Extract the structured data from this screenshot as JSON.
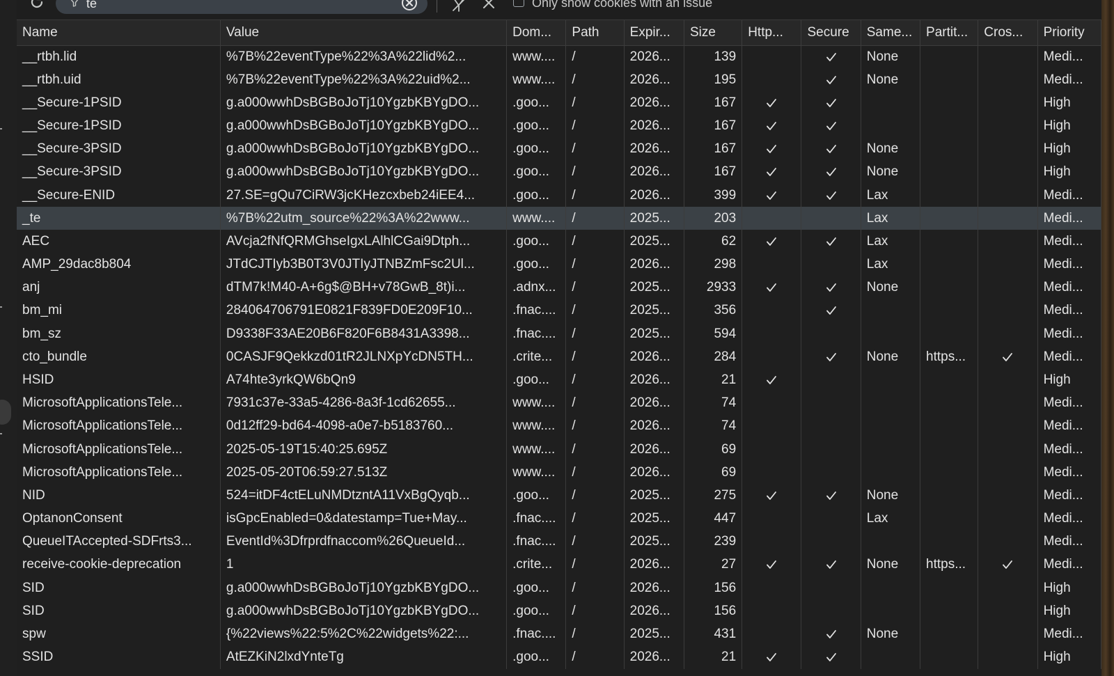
{
  "toolbar": {
    "filter_value": "te",
    "only_issue_label": "Only show cookies with an issue"
  },
  "icons": [
    "refresh-icon",
    "filter-icon",
    "clear-input-icon",
    "clear-filtered-cookies-icon",
    "delete-all-icon"
  ],
  "columns": [
    "Name",
    "Value",
    "Dom...",
    "Path",
    "Expir...",
    "Size",
    "Http...",
    "Secure",
    "Same...",
    "Partit...",
    "Cros...",
    "Priority"
  ],
  "rows": [
    {
      "name": "__rtbh.lid",
      "value": "%7B%22eventType%22%3A%22lid%2...",
      "domain": "www....",
      "path": "/",
      "expires": "2026...",
      "size": "139",
      "http": false,
      "secure": true,
      "samesite": "None",
      "partition": "",
      "cross": false,
      "priority": "Medi..."
    },
    {
      "name": "__rtbh.uid",
      "value": "%7B%22eventType%22%3A%22uid%2...",
      "domain": "www....",
      "path": "/",
      "expires": "2026...",
      "size": "195",
      "http": false,
      "secure": true,
      "samesite": "None",
      "partition": "",
      "cross": false,
      "priority": "Medi..."
    },
    {
      "name": "__Secure-1PSID",
      "value": "g.a000wwhDsBGBoJoTj10YgzbKBYgDO...",
      "domain": ".goo...",
      "path": "/",
      "expires": "2026...",
      "size": "167",
      "http": true,
      "secure": true,
      "samesite": "",
      "partition": "",
      "cross": false,
      "priority": "High"
    },
    {
      "name": "__Secure-1PSID",
      "value": "g.a000wwhDsBGBoJoTj10YgzbKBYgDO...",
      "domain": ".goo...",
      "path": "/",
      "expires": "2026...",
      "size": "167",
      "http": true,
      "secure": true,
      "samesite": "",
      "partition": "",
      "cross": false,
      "priority": "High"
    },
    {
      "name": "__Secure-3PSID",
      "value": "g.a000wwhDsBGBoJoTj10YgzbKBYgDO...",
      "domain": ".goo...",
      "path": "/",
      "expires": "2026...",
      "size": "167",
      "http": true,
      "secure": true,
      "samesite": "None",
      "partition": "",
      "cross": false,
      "priority": "High"
    },
    {
      "name": "__Secure-3PSID",
      "value": "g.a000wwhDsBGBoJoTj10YgzbKBYgDO...",
      "domain": ".goo...",
      "path": "/",
      "expires": "2026...",
      "size": "167",
      "http": true,
      "secure": true,
      "samesite": "None",
      "partition": "",
      "cross": false,
      "priority": "High"
    },
    {
      "name": "__Secure-ENID",
      "value": "27.SE=gQu7CiRW3jcKHezcxbeb24iEE4...",
      "domain": ".goo...",
      "path": "/",
      "expires": "2026...",
      "size": "399",
      "http": true,
      "secure": true,
      "samesite": "Lax",
      "partition": "",
      "cross": false,
      "priority": "Medi..."
    },
    {
      "name": "_te",
      "value": "%7B%22utm_source%22%3A%22www...",
      "domain": "www....",
      "path": "/",
      "expires": "2025...",
      "size": "203",
      "http": false,
      "secure": false,
      "samesite": "Lax",
      "partition": "",
      "cross": false,
      "priority": "Medi...",
      "selected": true
    },
    {
      "name": "AEC",
      "value": "AVcja2fNfQRMGhseIgxLAlhlCGai9Dtph...",
      "domain": ".goo...",
      "path": "/",
      "expires": "2025...",
      "size": "62",
      "http": true,
      "secure": true,
      "samesite": "Lax",
      "partition": "",
      "cross": false,
      "priority": "Medi..."
    },
    {
      "name": "AMP_29dac8b804",
      "value": "JTdCJTIyb3B0T3V0JTIyJTNBZmFsc2Ul...",
      "domain": ".goo...",
      "path": "/",
      "expires": "2026...",
      "size": "298",
      "http": false,
      "secure": false,
      "samesite": "Lax",
      "partition": "",
      "cross": false,
      "priority": "Medi..."
    },
    {
      "name": "anj",
      "value": "dTM7k!M40-A+6g$@BH+v78GwB_8t)i...",
      "domain": ".adnx...",
      "path": "/",
      "expires": "2025...",
      "size": "2933",
      "http": true,
      "secure": true,
      "samesite": "None",
      "partition": "",
      "cross": false,
      "priority": "Medi..."
    },
    {
      "name": "bm_mi",
      "value": "284064706791E0821F839FD0E209F10...",
      "domain": ".fnac....",
      "path": "/",
      "expires": "2025...",
      "size": "356",
      "http": false,
      "secure": true,
      "samesite": "",
      "partition": "",
      "cross": false,
      "priority": "Medi..."
    },
    {
      "name": "bm_sz",
      "value": "D9338F33AE20B6F820F6B8431A3398...",
      "domain": ".fnac....",
      "path": "/",
      "expires": "2025...",
      "size": "594",
      "http": false,
      "secure": false,
      "samesite": "",
      "partition": "",
      "cross": false,
      "priority": "Medi..."
    },
    {
      "name": "cto_bundle",
      "value": "0CASJF9Qekkzd01tR2JLNXpYcDN5TH...",
      "domain": ".crite...",
      "path": "/",
      "expires": "2026...",
      "size": "284",
      "http": false,
      "secure": true,
      "samesite": "None",
      "partition": "https...",
      "cross": true,
      "priority": "Medi..."
    },
    {
      "name": "HSID",
      "value": "A74hte3yrkQW6bQn9",
      "domain": ".goo...",
      "path": "/",
      "expires": "2026...",
      "size": "21",
      "http": true,
      "secure": false,
      "samesite": "",
      "partition": "",
      "cross": false,
      "priority": "High"
    },
    {
      "name": "MicrosoftApplicationsTele...",
      "value": "7931c37e-33a5-4286-8a3f-1cd62655...",
      "domain": "www....",
      "path": "/",
      "expires": "2026...",
      "size": "74",
      "http": false,
      "secure": false,
      "samesite": "",
      "partition": "",
      "cross": false,
      "priority": "Medi..."
    },
    {
      "name": "MicrosoftApplicationsTele...",
      "value": "0d12ff29-bd64-4098-a0e7-b5183760...",
      "domain": "www....",
      "path": "/",
      "expires": "2026...",
      "size": "74",
      "http": false,
      "secure": false,
      "samesite": "",
      "partition": "",
      "cross": false,
      "priority": "Medi..."
    },
    {
      "name": "MicrosoftApplicationsTele...",
      "value": "2025-05-19T15:40:25.695Z",
      "domain": "www....",
      "path": "/",
      "expires": "2026...",
      "size": "69",
      "http": false,
      "secure": false,
      "samesite": "",
      "partition": "",
      "cross": false,
      "priority": "Medi..."
    },
    {
      "name": "MicrosoftApplicationsTele...",
      "value": "2025-05-20T06:59:27.513Z",
      "domain": "www....",
      "path": "/",
      "expires": "2026...",
      "size": "69",
      "http": false,
      "secure": false,
      "samesite": "",
      "partition": "",
      "cross": false,
      "priority": "Medi..."
    },
    {
      "name": "NID",
      "value": "524=itDF4ctELuNMDtzntA11VxBgQyqb...",
      "domain": ".goo...",
      "path": "/",
      "expires": "2025...",
      "size": "275",
      "http": true,
      "secure": true,
      "samesite": "None",
      "partition": "",
      "cross": false,
      "priority": "Medi..."
    },
    {
      "name": "OptanonConsent",
      "value": "isGpcEnabled=0&datestamp=Tue+May...",
      "domain": ".fnac....",
      "path": "/",
      "expires": "2025...",
      "size": "447",
      "http": false,
      "secure": false,
      "samesite": "Lax",
      "partition": "",
      "cross": false,
      "priority": "Medi..."
    },
    {
      "name": "QueueITAccepted-SDFrts3...",
      "value": "EventId%3Dfrprdfnaccom%26QueueId...",
      "domain": ".fnac....",
      "path": "/",
      "expires": "2025...",
      "size": "239",
      "http": false,
      "secure": false,
      "samesite": "",
      "partition": "",
      "cross": false,
      "priority": "Medi..."
    },
    {
      "name": "receive-cookie-deprecation",
      "value": "1",
      "domain": ".crite...",
      "path": "/",
      "expires": "2026...",
      "size": "27",
      "http": true,
      "secure": true,
      "samesite": "None",
      "partition": "https...",
      "cross": true,
      "priority": "Medi..."
    },
    {
      "name": "SID",
      "value": "g.a000wwhDsBGBoJoTj10YgzbKBYgDO...",
      "domain": ".goo...",
      "path": "/",
      "expires": "2026...",
      "size": "156",
      "http": false,
      "secure": false,
      "samesite": "",
      "partition": "",
      "cross": false,
      "priority": "High"
    },
    {
      "name": "SID",
      "value": "g.a000wwhDsBGBoJoTj10YgzbKBYgDO...",
      "domain": ".goo...",
      "path": "/",
      "expires": "2026...",
      "size": "156",
      "http": false,
      "secure": false,
      "samesite": "",
      "partition": "",
      "cross": false,
      "priority": "High"
    },
    {
      "name": "spw",
      "value": "{%22views%22:5%2C%22widgets%22:...",
      "domain": ".fnac....",
      "path": "/",
      "expires": "2025...",
      "size": "431",
      "http": false,
      "secure": true,
      "samesite": "None",
      "partition": "",
      "cross": false,
      "priority": "Medi..."
    },
    {
      "name": "SSID",
      "value": "AtEZKiN2lxdYnteTg",
      "domain": ".goo...",
      "path": "/",
      "expires": "2026...",
      "size": "21",
      "http": true,
      "secure": true,
      "samesite": "",
      "partition": "",
      "cross": false,
      "priority": "High"
    }
  ]
}
